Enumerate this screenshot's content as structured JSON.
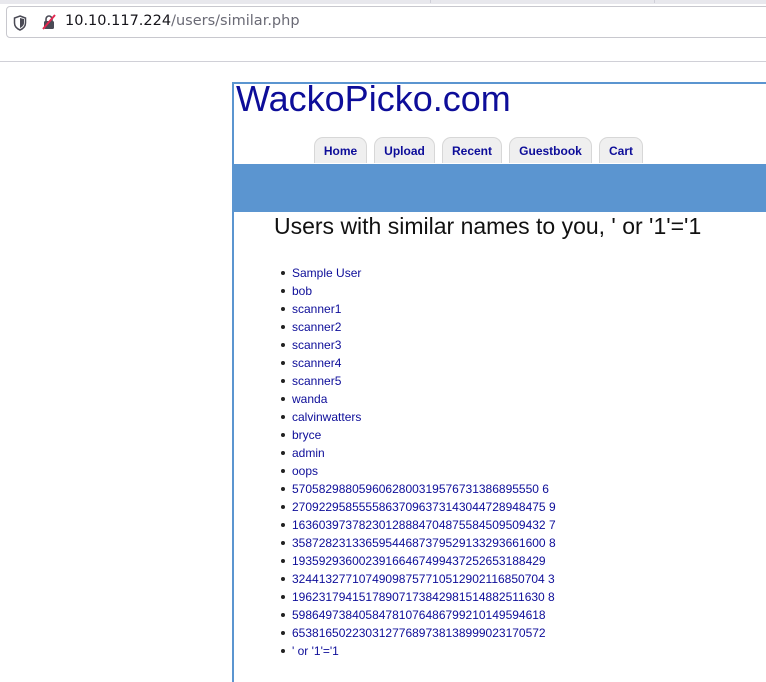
{
  "browser": {
    "url_host": "10.10.117.224",
    "url_path": "/users/similar.php"
  },
  "site": {
    "logo": "WackoPicko.com",
    "nav": {
      "home": "Home",
      "upload": "Upload",
      "recent": "Recent",
      "guestbook": "Guestbook",
      "cart": "Cart"
    },
    "accent_color": "#5b95d0",
    "link_color": "#0d0d99"
  },
  "main": {
    "heading": "Users with similar names to you, ' or '1'='1",
    "users": [
      "Sample User",
      "bob",
      "scanner1",
      "scanner2",
      "scanner3",
      "scanner4",
      "scanner5",
      "wanda",
      "calvinwatters",
      "bryce",
      "admin",
      "oops",
      "5705829880596062800319576731386895550 6",
      "27092295855558637096373143044728948475 9",
      "16360397378230128884704875584509509432 7",
      "35872823133659544687379529133293661600 8",
      "19359293600239166467499437252653188429",
      "32441327710749098757710512902116850704 3",
      "19623179415178907173842981514882511630 8",
      "59864973840584781076486799210149594618",
      "65381650223031277689738138999023170572",
      "' or '1'='1"
    ]
  }
}
